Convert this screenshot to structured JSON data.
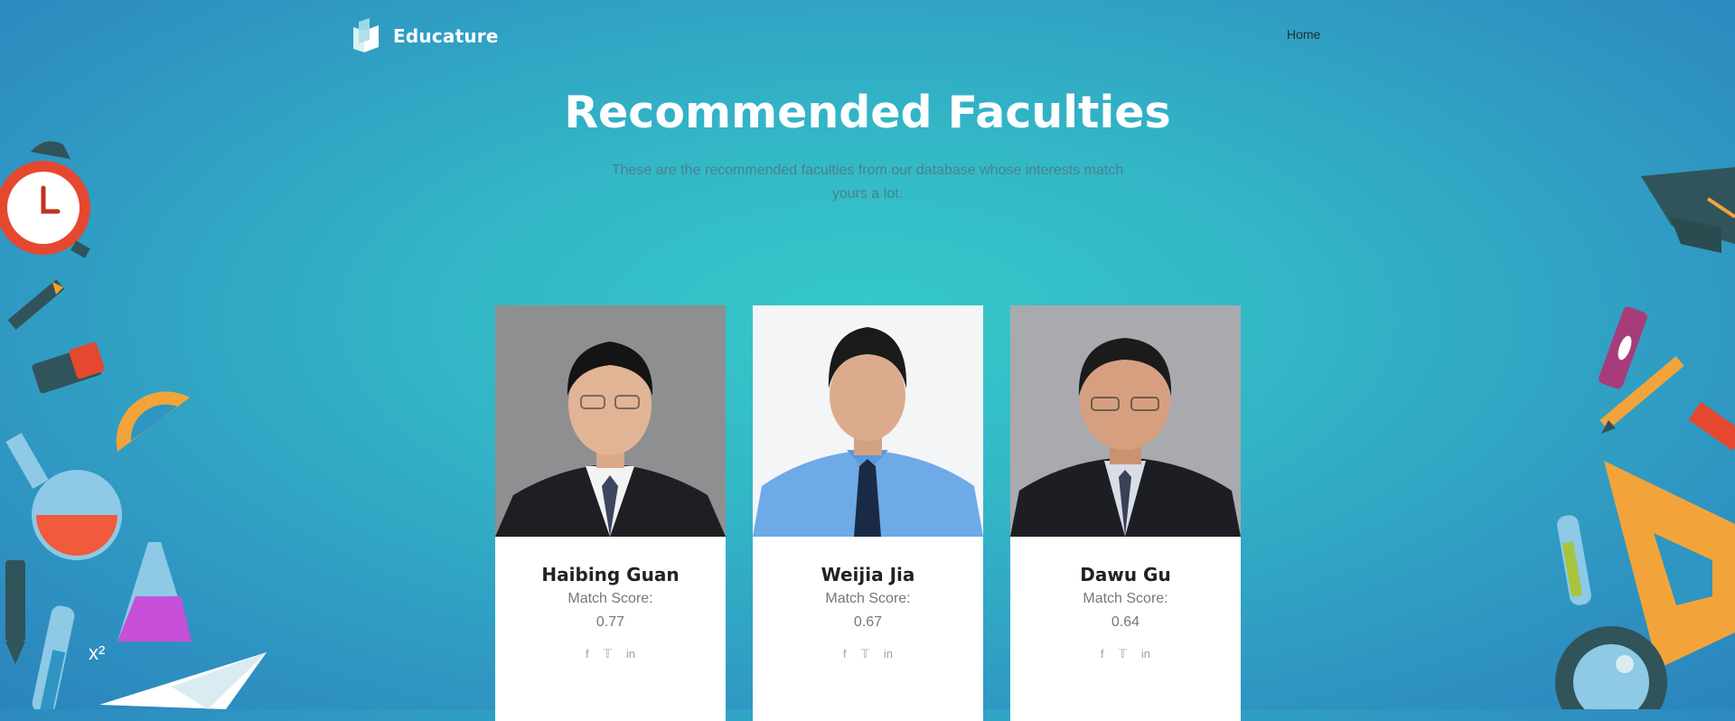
{
  "brand": {
    "name": "Educature"
  },
  "nav": {
    "home_label": "Home"
  },
  "hero": {
    "title": "Recommended Faculties",
    "subtitle": "These are the recommended faculties from our database whose interests match yours a lot."
  },
  "cards": [
    {
      "name": "Haibing Guan",
      "score_label": "Match Score:",
      "score": "0.77"
    },
    {
      "name": "Weijia Jia",
      "score_label": "Match Score:",
      "score": "0.67"
    },
    {
      "name": "Dawu Gu",
      "score_label": "Match Score:",
      "score": "0.64"
    }
  ],
  "social_icons": [
    "facebook-icon",
    "twitter-icon",
    "linkedin-icon"
  ],
  "decorations": {
    "formula": "x²"
  }
}
